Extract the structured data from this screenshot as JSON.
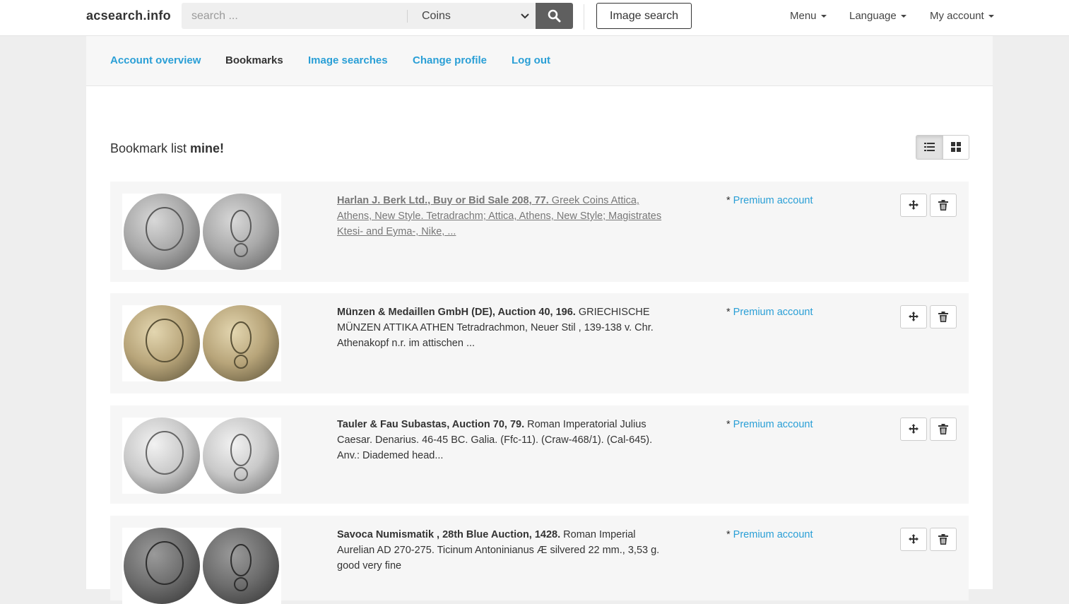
{
  "navbar": {
    "brand": "acsearch.info",
    "search_placeholder": "search ...",
    "category_selected": "Coins",
    "image_search_label": "Image search",
    "menu_label": "Menu",
    "language_label": "Language",
    "account_label": "My account"
  },
  "subnav": {
    "items": [
      {
        "label": "Account overview",
        "active": false
      },
      {
        "label": "Bookmarks",
        "active": true
      },
      {
        "label": "Image searches",
        "active": false
      },
      {
        "label": "Change profile",
        "active": false
      },
      {
        "label": "Log out",
        "active": false
      }
    ]
  },
  "main": {
    "title_prefix": "Bookmark list",
    "title_name": "mine!",
    "view_modes": [
      "list",
      "grid"
    ],
    "active_view": "list"
  },
  "bookmarks": [
    {
      "lot_title": "Harlan J. Berk Ltd., Buy or Bid Sale 208, 77.",
      "description": " Greek Coins Attica, Athens, New Style. Tetradrachm; Attica, Athens, New Style; Magistrates Ktesi- and Eyma-, Nike, ...",
      "premium_prefix": "* ",
      "premium_link": "Premium account",
      "coin_tone": "silver"
    },
    {
      "lot_title": "Münzen & Medaillen GmbH (DE), Auction 40, 196.",
      "description": " GRIECHISCHE MÜNZEN ATTIKA ATHEN Tetradrachmon, Neuer Stil , 139-138 v. Chr. Athenakopf n.r. im attischen ...",
      "premium_prefix": "* ",
      "premium_link": "Premium account",
      "coin_tone": "toned"
    },
    {
      "lot_title": "Tauler & Fau Subastas, Auction 70, 79.",
      "description": " Roman Imperatorial Julius Caesar. Denarius. 46-45 BC. Galia. (Ffc-11). (Craw-468/1). (Cal-645). Anv.: Diademed head...",
      "premium_prefix": "* ",
      "premium_link": "Premium account",
      "coin_tone": "bright"
    },
    {
      "lot_title": "Savoca Numismatik , 28th Blue Auction, 1428.",
      "description": " Roman Imperial Aurelian AD 270-275. Ticinum Antoninianus Æ silvered 22 mm., 3,53 g. good very fine",
      "premium_prefix": "* ",
      "premium_link": "Premium account",
      "coin_tone": "dark"
    }
  ],
  "colors": {
    "link": "#2a9fd6",
    "search_button": "#5f5f5f",
    "item_background": "#f6f6f6"
  }
}
